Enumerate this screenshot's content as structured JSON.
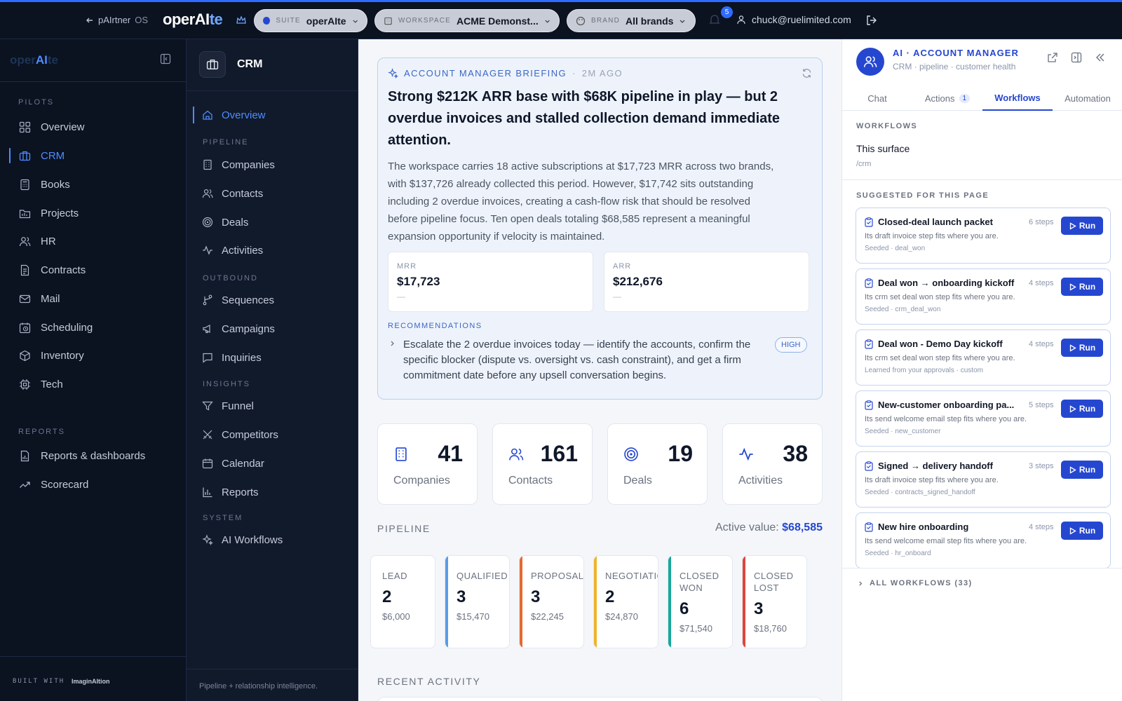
{
  "topbar": {
    "back_label": "pAIrtner",
    "back_suffix": "OS",
    "logo_main": "operAI",
    "logo_accent": "te",
    "suite": {
      "label": "SUITE",
      "value": "operAIte"
    },
    "workspace": {
      "label": "WORKSPACE",
      "value": "ACME Demonst..."
    },
    "brand": {
      "label": "BRAND",
      "value": "All brands"
    },
    "notifications": "5",
    "user_email": "chuck@ruelimited.com"
  },
  "sidebar": {
    "logo_a": "oper",
    "logo_b": "AI",
    "logo_c": "te",
    "pilots_label": "PILOTS",
    "pilots": [
      {
        "label": "Overview",
        "icon": "grid-icon"
      },
      {
        "label": "CRM",
        "icon": "briefcase-icon"
      },
      {
        "label": "Books",
        "icon": "calculator-icon"
      },
      {
        "label": "Projects",
        "icon": "folder-icon"
      },
      {
        "label": "HR",
        "icon": "users-icon"
      },
      {
        "label": "Contracts",
        "icon": "document-icon"
      },
      {
        "label": "Mail",
        "icon": "mail-icon"
      },
      {
        "label": "Scheduling",
        "icon": "calendar-clock-icon"
      },
      {
        "label": "Inventory",
        "icon": "box-icon"
      },
      {
        "label": "Tech",
        "icon": "chip-icon"
      }
    ],
    "reports_label": "REPORTS",
    "reports": [
      {
        "label": "Reports & dashboards",
        "icon": "report-icon"
      },
      {
        "label": "Scorecard",
        "icon": "trend-icon"
      }
    ],
    "built_with": "BUILT WITH",
    "built_brand": "ImaginAItion"
  },
  "subnav": {
    "title": "CRM",
    "overview": "Overview",
    "pipeline_label": "PIPELINE",
    "pipeline": [
      "Companies",
      "Contacts",
      "Deals",
      "Activities"
    ],
    "outbound_label": "OUTBOUND",
    "outbound": [
      "Sequences",
      "Campaigns",
      "Inquiries"
    ],
    "insights_label": "INSIGHTS",
    "insights": [
      "Funnel",
      "Competitors",
      "Calendar",
      "Reports"
    ],
    "system_label": "SYSTEM",
    "system": [
      "AI Workflows"
    ],
    "footer": "Pipeline + relationship intelligence."
  },
  "briefing": {
    "label": "ACCOUNT MANAGER BRIEFING",
    "ago": "2M AGO",
    "title": "Strong $212K ARR base with $68K pipeline in play — but 2 overdue invoices and stalled collection demand immediate attention.",
    "body": "The workspace carries 18 active subscriptions at $17,723 MRR across two brands, with $137,726 already collected this period. However, $17,742 sits outstanding including 2 overdue invoices, creating a cash-flow risk that should be resolved before pipeline focus. Ten open deals totaling $68,585 represent a meaningful expansion opportunity if velocity is maintained.",
    "metrics": [
      {
        "label": "MRR",
        "value": "$17,723",
        "delta": "—"
      },
      {
        "label": "ARR",
        "value": "$212,676",
        "delta": "—"
      }
    ],
    "rec_label": "RECOMMENDATIONS",
    "rec_text": "Escalate the 2 overdue invoices today — identify the accounts, confirm the specific blocker (dispute vs. oversight vs. cash constraint), and get a firm commitment date before any upsell conversation begins.",
    "rec_priority": "HIGH"
  },
  "stats": [
    {
      "number": "41",
      "label": "Companies"
    },
    {
      "number": "161",
      "label": "Contacts"
    },
    {
      "number": "19",
      "label": "Deals"
    },
    {
      "number": "38",
      "label": "Activities"
    }
  ],
  "pipeline": {
    "label": "PIPELINE",
    "active_label": "Active value:",
    "active_value": "$68,585",
    "stages": [
      {
        "name": "LEAD",
        "count": "2",
        "amount": "$6,000",
        "color": "#ffffff"
      },
      {
        "name": "QUALIFIED",
        "count": "3",
        "amount": "$15,470",
        "color": "#5b9be8"
      },
      {
        "name": "PROPOSAL",
        "count": "3",
        "amount": "$22,245",
        "color": "#e4692f"
      },
      {
        "name": "NEGOTIATION",
        "count": "2",
        "amount": "$24,870",
        "color": "#f0b429"
      },
      {
        "name": "CLOSED WON",
        "count": "6",
        "amount": "$71,540",
        "color": "#17a89a"
      },
      {
        "name": "CLOSED LOST",
        "count": "3",
        "amount": "$18,760",
        "color": "#e0453a"
      }
    ]
  },
  "recent_label": "RECENT ACTIVITY",
  "panel": {
    "title": "AI · ACCOUNT MANAGER",
    "subtitle": "CRM · pipeline · customer health",
    "tabs": [
      {
        "label": "Chat"
      },
      {
        "label": "Actions",
        "count": "1"
      },
      {
        "label": "Workflows"
      },
      {
        "label": "Automation"
      }
    ],
    "workflows_label": "WORKFLOWS",
    "surface": "This surface",
    "surface_path": "/crm",
    "suggested_label": "SUGGESTED FOR THIS PAGE",
    "run_label": "Run",
    "workflows": [
      {
        "title": "Closed-deal launch packet",
        "steps": "6 steps",
        "desc": "Its draft invoice step fits where you are.",
        "source": "Seeded · deal_won"
      },
      {
        "title": "Deal won → onboarding kickoff",
        "steps": "4 steps",
        "desc": "Its crm set deal won step fits where you are.",
        "source": "Seeded · crm_deal_won"
      },
      {
        "title": "Deal won - Demo Day kickoff",
        "steps": "4 steps",
        "desc": "Its crm set deal won step fits where you are.",
        "source": "Learned from your approvals · custom"
      },
      {
        "title": "New-customer onboarding pa...",
        "steps": "5 steps",
        "desc": "Its send welcome email step fits where you are.",
        "source": "Seeded · new_customer"
      },
      {
        "title": "Signed → delivery handoff",
        "steps": "3 steps",
        "desc": "Its draft invoice step fits where you are.",
        "source": "Seeded · contracts_signed_handoff"
      },
      {
        "title": "New hire onboarding",
        "steps": "4 steps",
        "desc": "Its send welcome email step fits where you are.",
        "source": "Seeded · hr_onboard"
      }
    ],
    "all_workflows": "ALL WORKFLOWS (33)"
  }
}
